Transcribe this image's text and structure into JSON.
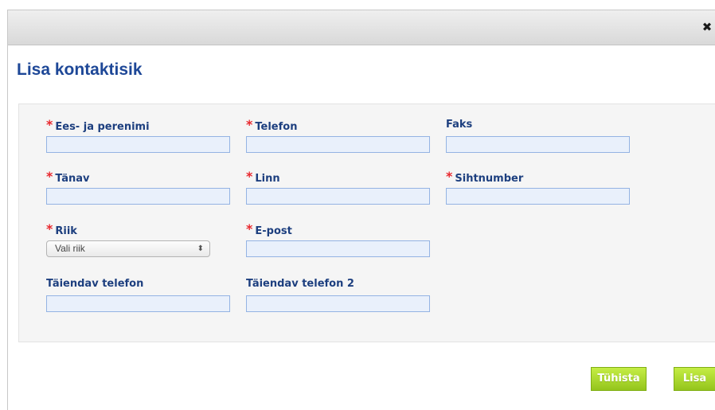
{
  "dialog": {
    "close_symbol": "✖",
    "title": "Lisa kontaktisik"
  },
  "form": {
    "required_marker": "*",
    "fields": {
      "name": {
        "label": "Ees- ja perenimi",
        "required": true,
        "value": ""
      },
      "phone": {
        "label": "Telefon",
        "required": true,
        "value": ""
      },
      "fax": {
        "label": "Faks",
        "required": false,
        "value": ""
      },
      "street": {
        "label": "Tänav",
        "required": true,
        "value": ""
      },
      "city": {
        "label": "Linn",
        "required": true,
        "value": ""
      },
      "postcode": {
        "label": "Sihtnumber",
        "required": true,
        "value": ""
      },
      "country": {
        "label": "Riik",
        "required": true,
        "selected": "Vali riik",
        "arrow": "⬍"
      },
      "email": {
        "label": "E-post",
        "required": true,
        "value": ""
      },
      "extra_phone": {
        "label": "Täiendav telefon",
        "required": false,
        "value": ""
      },
      "extra_phone2": {
        "label": "Täiendav telefon 2",
        "required": false,
        "value": ""
      }
    }
  },
  "buttons": {
    "cancel": "Tühista",
    "add": "Lisa"
  },
  "colors": {
    "title": "#1d4797",
    "label": "#1d3f7f",
    "required": "#e8272d",
    "button": "#9bcb1f"
  }
}
